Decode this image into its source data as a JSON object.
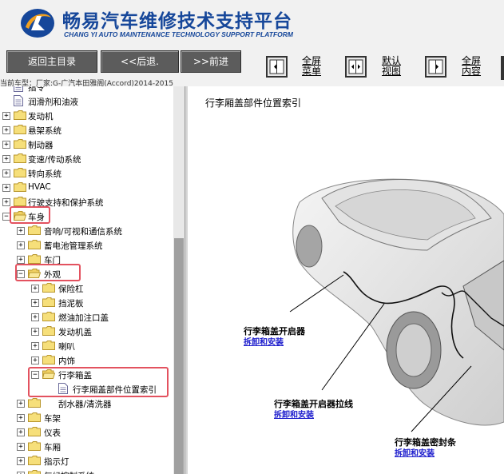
{
  "header": {
    "title_cn": "畅易汽车维修技术支持平台",
    "title_en": "CHANG YI AUTO MAINTENANCE TECHNOLOGY SUPPORT PLATFORM",
    "brand_color": "#16479a"
  },
  "toolbar": {
    "back_label": "返回主目录",
    "prev_label": "<<后退.",
    "next_label": ">>前进",
    "fullscreen_menu": [
      "全屏",
      "菜单"
    ],
    "default_view": [
      "默认",
      "视图"
    ],
    "fullscreen_content": [
      "全屏",
      "内容"
    ]
  },
  "breadcrumb": "当前车型：厂家:G-广汽本田雅阁(Accord)2014-2015",
  "tree": {
    "top_partial": "指令",
    "items": [
      {
        "label": "润滑剂和油液",
        "type": "doc"
      },
      {
        "label": "发动机",
        "type": "folder"
      },
      {
        "label": "悬架系统",
        "type": "folder"
      },
      {
        "label": "制动器",
        "type": "folder"
      },
      {
        "label": "变速/传动系统",
        "type": "folder"
      },
      {
        "label": "转向系统",
        "type": "folder"
      },
      {
        "label": "HVAC",
        "type": "folder"
      },
      {
        "label": "行驶支持和保护系统",
        "type": "folder"
      },
      {
        "label": "车身",
        "type": "folder"
      },
      {
        "label": "音响/可视和通信系统",
        "type": "folder"
      },
      {
        "label": "蓄电池管理系统",
        "type": "folder"
      },
      {
        "label": "车门",
        "type": "folder"
      },
      {
        "label": "外观",
        "type": "folder"
      },
      {
        "label": "保险杠",
        "type": "folder"
      },
      {
        "label": "挡泥板",
        "type": "folder"
      },
      {
        "label": "燃油加注口盖",
        "type": "folder"
      },
      {
        "label": "发动机盖",
        "type": "folder"
      },
      {
        "label": "喇叭",
        "type": "folder"
      },
      {
        "label": "内饰",
        "type": "folder"
      },
      {
        "label": "行李箱盖",
        "type": "folder"
      },
      {
        "label": "行李厢盖部件位置索引",
        "type": "doc"
      },
      {
        "label": "刮水器/清洗器",
        "type": "folder"
      },
      {
        "label": "车架",
        "type": "folder"
      },
      {
        "label": "仪表",
        "type": "folder"
      },
      {
        "label": "车厢",
        "type": "folder"
      },
      {
        "label": "指示灯",
        "type": "folder"
      },
      {
        "label": "气候控制系统",
        "type": "folder"
      }
    ]
  },
  "content": {
    "title": "行李厢盖部件位置索引",
    "callouts": [
      {
        "label": "行李箱盖开启器",
        "link": "拆卸和安装"
      },
      {
        "label": "行李箱盖开启器拉线",
        "link": "拆卸和安装"
      },
      {
        "label": "行李箱盖密封条",
        "link": "拆卸和安装"
      }
    ]
  },
  "colors": {
    "highlight": "#e3525f",
    "link": "#1a1acc",
    "button_bg": "#5c5c5c"
  }
}
